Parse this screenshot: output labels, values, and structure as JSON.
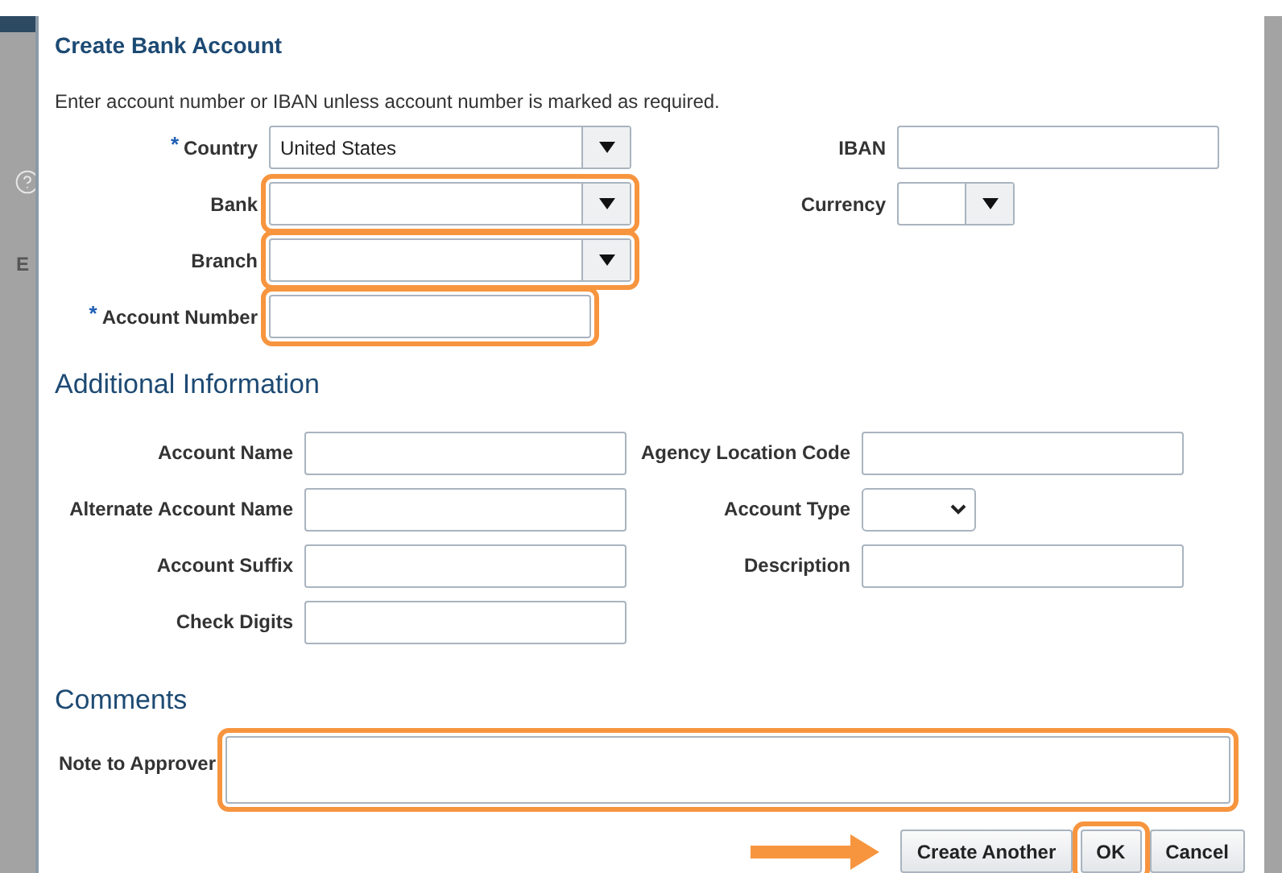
{
  "background": {
    "text": "E"
  },
  "dialog": {
    "title": "Create Bank Account",
    "instruction": "Enter account number or IBAN unless account number is marked as required.",
    "left_fields": [
      {
        "label": "Country",
        "required_mark": "*",
        "kind": "combo",
        "value": "United States",
        "highlighted": false
      },
      {
        "label": "Bank",
        "kind": "combo",
        "highlighted": true
      },
      {
        "label": "Branch",
        "kind": "combo",
        "highlighted": true
      },
      {
        "label": "Account Number",
        "required_mark": "*",
        "kind": "text",
        "highlighted": true
      }
    ],
    "right_fields": [
      {
        "label": "IBAN",
        "kind": "text"
      },
      {
        "label": "Currency",
        "kind": "combo_short"
      }
    ],
    "additional": {
      "heading": "Additional Information",
      "left_fields": [
        {
          "label": "Account Name",
          "kind": "text"
        },
        {
          "label": "Alternate Account Name",
          "kind": "text"
        },
        {
          "label": "Account Suffix",
          "kind": "text"
        },
        {
          "label": "Check Digits",
          "kind": "text"
        }
      ],
      "right_fields": [
        {
          "label": "Agency Location Code",
          "kind": "text"
        },
        {
          "label": "Account Type",
          "kind": "select"
        },
        {
          "label": "Description",
          "kind": "text"
        }
      ]
    },
    "comments": {
      "heading": "Comments",
      "note": {
        "label": "Note to Approver",
        "highlighted": true
      }
    },
    "footer": {
      "arrow": true,
      "buttons": [
        {
          "label": "Create Another",
          "highlighted": false
        },
        {
          "label": "OK",
          "highlighted": true
        },
        {
          "label": "Cancel",
          "highlighted": false
        }
      ]
    }
  }
}
